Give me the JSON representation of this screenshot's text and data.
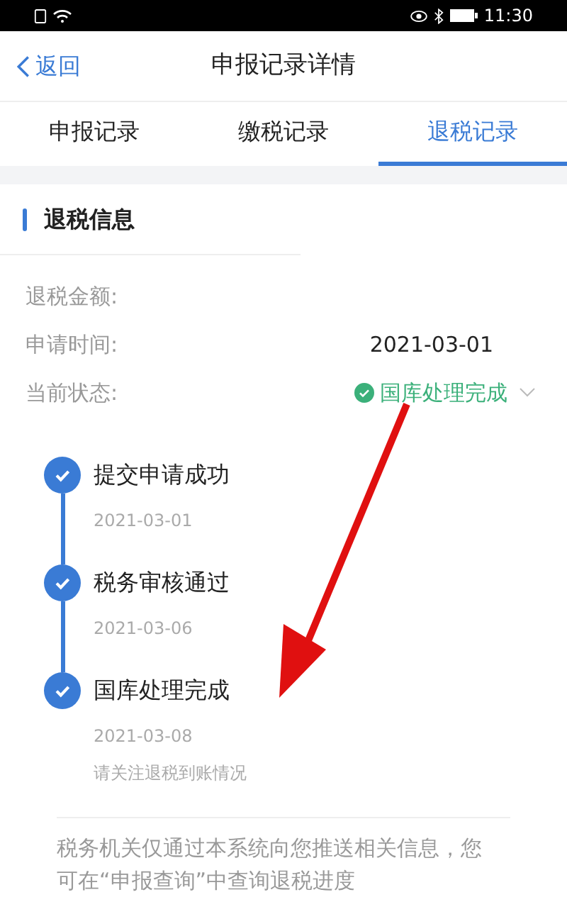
{
  "status_bar": {
    "time": "11:30"
  },
  "nav": {
    "back": "返回",
    "title": "申报记录详情"
  },
  "tabs": [
    {
      "label": "申报记录",
      "selected": false
    },
    {
      "label": "缴税记录",
      "selected": false
    },
    {
      "label": "退税记录",
      "selected": true
    }
  ],
  "section": {
    "title": "退税信息"
  },
  "fields": [
    {
      "label": "退税金额:"
    },
    {
      "label": "申请时间:",
      "value": "2021-03-01"
    },
    {
      "label": "当前状态:",
      "value": "国库处理完成",
      "kind": "status"
    }
  ],
  "timeline": [
    {
      "title": "提交申请成功",
      "date": "2021-03-01",
      "done": true
    },
    {
      "title": "税务审核通过",
      "date": "2021-03-06",
      "done": true
    },
    {
      "title": "国库处理完成",
      "date": "2021-03-08",
      "note": "请关注退税到账情况",
      "done": true
    }
  ],
  "footer": "税务机关仅通过本系统向您推送相关信息，您可在“申报查询”中查询退税进度"
}
